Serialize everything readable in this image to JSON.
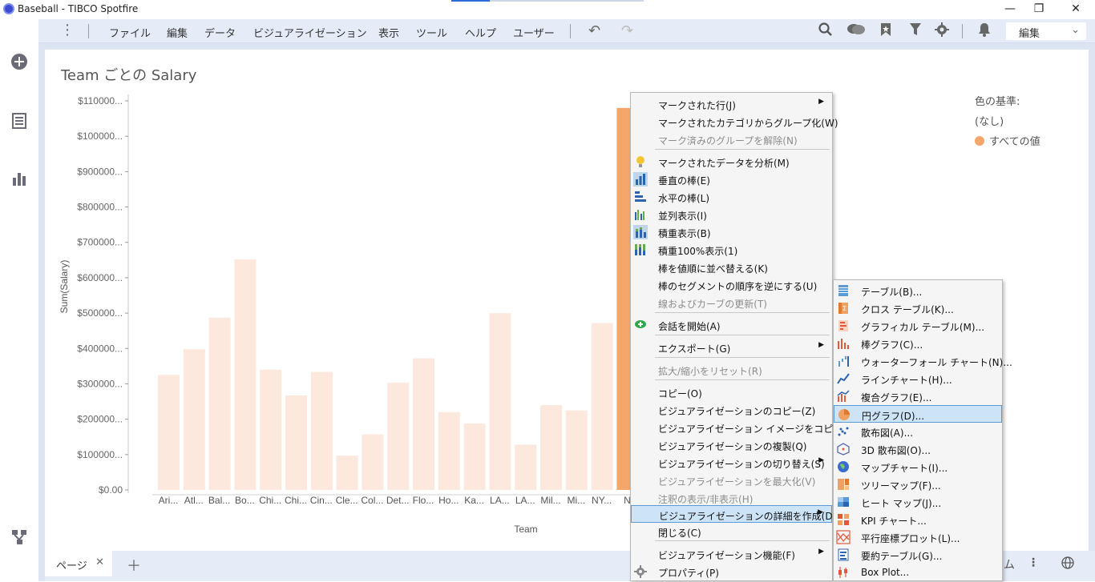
{
  "window": {
    "title": "Baseball - TIBCO Spotfire",
    "minimize": "—",
    "restore": "❐",
    "close": "✕"
  },
  "menu": {
    "items": [
      "ファイル",
      "編集",
      "データ",
      "ビジュアライゼーション",
      "表示",
      "ツール",
      "ヘルプ",
      "ユーザー"
    ],
    "mode_label": "編集"
  },
  "visualization": {
    "title": "Team ごとの Salary",
    "legend_title": "色の基準:",
    "legend_none": "(なし)",
    "legend_item": "すべての値",
    "legend_color": "#f5a66a"
  },
  "chart_data": {
    "type": "bar",
    "xlabel": "Team",
    "ylabel": "Sum(Salary)",
    "ylim": [
      0,
      1100000
    ],
    "y_ticks": [
      "$0.00",
      "$100000...",
      "$200000...",
      "$300000...",
      "$400000...",
      "$500000...",
      "$600000...",
      "$700000...",
      "$800000...",
      "$900000...",
      "$100000...",
      "$110000..."
    ],
    "categories": [
      "Ari...",
      "Atl...",
      "Bal...",
      "Bo...",
      "Chi...",
      "Chi...",
      "Cin...",
      "Cle...",
      "Col...",
      "Det...",
      "Flo...",
      "Ho...",
      "Ka...",
      "LA...",
      "LA...",
      "Mil...",
      "Mi...",
      "NY...",
      "N"
    ],
    "values": [
      325000,
      398000,
      487000,
      652000,
      340000,
      267000,
      334000,
      97000,
      157000,
      303000,
      372000,
      220000,
      188000,
      500000,
      128000,
      240000,
      225000,
      472000,
      1080000
    ],
    "bar_color": "#fde8dd",
    "marked_bar_color": "#f5a66a"
  },
  "pages": {
    "tab_label": "ページ",
    "close_glyph": "✕",
    "add_glyph": "＋",
    "right_text": "ム"
  },
  "context_menu": {
    "items": [
      {
        "label": "マークされた行(J)",
        "submenu": true
      },
      {
        "label": "マークされたカテゴリからグループ化(W)"
      },
      {
        "label": "マーク済みのグループを解除(N)",
        "disabled": true
      },
      {
        "label": "マークされたデータを分析(M)",
        "icon": "lightbulb-icon"
      },
      {
        "label": "垂直の棒(E)",
        "icon": "vertical-bars-icon"
      },
      {
        "label": "水平の棒(L)",
        "icon": "horizontal-bars-icon"
      },
      {
        "label": "並列表示(I)",
        "icon": "side-by-side-icon"
      },
      {
        "label": "積重表示(B)",
        "icon": "stacked-icon"
      },
      {
        "label": "積重100%表示(1)",
        "icon": "stacked-100-icon"
      },
      {
        "label": "棒を値順に並べ替える(K)"
      },
      {
        "label": "棒のセグメントの順序を逆にする(U)"
      },
      {
        "label": "線およびカーブの更新(T)",
        "disabled": true
      },
      {
        "label": "会話を開始(A)",
        "icon": "chat-icon"
      },
      {
        "label": "エクスポート(G)",
        "submenu": true
      },
      {
        "label": "拡大/縮小をリセット(R)",
        "disabled": true
      },
      {
        "label": "コピー(O)"
      },
      {
        "label": "ビジュアライゼーションのコピー(Z)"
      },
      {
        "label": "ビジュアライゼーション イメージをコピー(X)"
      },
      {
        "label": "ビジュアライゼーションの複製(Q)"
      },
      {
        "label": "ビジュアライゼーションの切り替え(S)",
        "submenu": true
      },
      {
        "label": "ビジュアライゼーションを最大化(V)",
        "disabled": true
      },
      {
        "label": "注釈の表示/非表示(H)",
        "disabled": true
      },
      {
        "label": "ビジュアライゼーションの詳細を作成(D)",
        "submenu": true,
        "highlighted": true
      },
      {
        "label": "閉じる(C)"
      },
      {
        "label": "ビジュアライゼーション機能(F)",
        "submenu": true
      },
      {
        "label": "プロパティ(P)",
        "icon": "gear-icon"
      }
    ],
    "submenu_items": [
      {
        "label": "テーブル(B)...",
        "icon": "table-icon"
      },
      {
        "label": "クロス テーブル(K)...",
        "icon": "cross-table-icon"
      },
      {
        "label": "グラフィカル テーブル(M)...",
        "icon": "graphical-table-icon"
      },
      {
        "label": "棒グラフ(C)...",
        "icon": "bar-chart-icon"
      },
      {
        "label": "ウォーターフォール チャート(N)...",
        "icon": "waterfall-icon"
      },
      {
        "label": "ラインチャート(H)...",
        "icon": "line-chart-icon"
      },
      {
        "label": "複合グラフ(E)...",
        "icon": "combo-chart-icon"
      },
      {
        "label": "円グラフ(D)...",
        "icon": "pie-chart-icon",
        "highlighted": true
      },
      {
        "label": "散布図(A)...",
        "icon": "scatter-icon"
      },
      {
        "label": "3D 散布図(O)...",
        "icon": "scatter-3d-icon"
      },
      {
        "label": "マップチャート(I)...",
        "icon": "map-chart-icon"
      },
      {
        "label": "ツリーマップ(F)...",
        "icon": "treemap-icon"
      },
      {
        "label": "ヒート マップ(J)...",
        "icon": "heatmap-icon"
      },
      {
        "label": "KPI チャート...",
        "icon": "kpi-icon"
      },
      {
        "label": "平行座標プロット(L)...",
        "icon": "parallel-coords-icon"
      },
      {
        "label": "要約テーブル(G)...",
        "icon": "summary-table-icon"
      },
      {
        "label": "Box Plot...",
        "icon": "box-plot-icon"
      }
    ]
  }
}
